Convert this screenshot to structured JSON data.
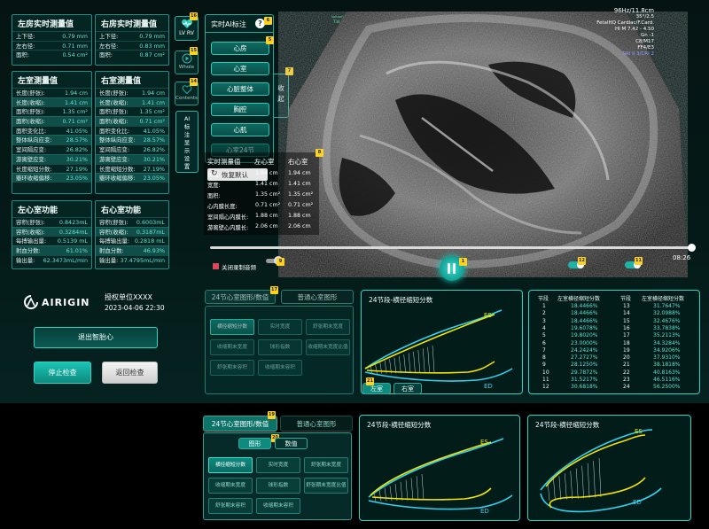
{
  "atrium_left": {
    "title": "左房实时测量值",
    "rows": [
      [
        "上下径:",
        "0.79 mm"
      ],
      [
        "左右径:",
        "0.71 mm"
      ],
      [
        "面积:",
        "0.54 cm²"
      ]
    ]
  },
  "atrium_right": {
    "title": "右房实时测量值",
    "rows": [
      [
        "上下径:",
        "0.79 mm"
      ],
      [
        "左右径:",
        "0.83 mm"
      ],
      [
        "面积:",
        "0.87 cm²"
      ]
    ]
  },
  "lv_measure": {
    "title": "左室测量值",
    "rows": [
      [
        "长度(舒张):",
        "1.94 cm"
      ],
      [
        "长度(收缩):",
        "1.41 cm"
      ],
      [
        "面积(舒张):",
        "1.35 cm²"
      ],
      [
        "面积(收缩):",
        "0.71 cm²"
      ],
      [
        "面积变化比:",
        "41.05%"
      ],
      [
        "整体纵向应变:",
        "28.57%"
      ],
      [
        "室间隔应变:",
        "26.82%"
      ],
      [
        "游离壁应变:",
        "30.21%"
      ],
      [
        "长度缩短分数:",
        "27.19%"
      ],
      [
        "瓣环收缩偏移:",
        "23.05%"
      ]
    ]
  },
  "rv_measure": {
    "title": "右室测量值",
    "rows": [
      [
        "长度(舒张):",
        "1.94 cm"
      ],
      [
        "长度(收缩):",
        "1.41 cm"
      ],
      [
        "面积(舒张):",
        "1.35 cm²"
      ],
      [
        "面积(收缩):",
        "0.71 cm²"
      ],
      [
        "面积变化比:",
        "41.05%"
      ],
      [
        "整体纵向应变:",
        "28.57%"
      ],
      [
        "室间隔应变:",
        "26.82%"
      ],
      [
        "游离壁应变:",
        "30.21%"
      ],
      [
        "长度缩短分数:",
        "27.19%"
      ],
      [
        "瓣环收缩偏移:",
        "23.05%"
      ]
    ]
  },
  "lv_func": {
    "title": "左心室功能",
    "rows": [
      [
        "容积(舒张):",
        "0.8423mL"
      ],
      [
        "容积(收缩):",
        "0.3284mL"
      ],
      [
        "每搏输出量:",
        "0.5139 mL"
      ],
      [
        "射血分数:",
        "61.01%"
      ],
      [
        "输出量:",
        "62.3473mL/min"
      ]
    ]
  },
  "rv_func": {
    "title": "右心室功能",
    "rows": [
      [
        "容积(舒张):",
        "0.6003mL"
      ],
      [
        "容积(收缩):",
        "0.3187mL"
      ],
      [
        "每搏输出量:",
        "0.2818 mL"
      ],
      [
        "射血分数:",
        "46.93%"
      ],
      [
        "输出量:",
        "37.4795mL/min"
      ]
    ]
  },
  "views": [
    {
      "label": "LV RV",
      "badge": "16"
    },
    {
      "label": "Whole",
      "badge": "15"
    },
    {
      "label": "Contents",
      "badge": "14"
    }
  ],
  "ai_side_label": "AI标注显示设置",
  "ai_panel": {
    "title": "实时AI标注",
    "badge_title": "6",
    "badge_side": "7",
    "badge_list": "5",
    "collapse": "收起",
    "items": [
      "心房",
      "心室",
      "心脏整体",
      "胸腔",
      "心肌",
      "心室24节"
    ]
  },
  "realtime": {
    "title": "实时测量值",
    "left_col": "左心室",
    "right_col": "右心室",
    "restore": "恢复默认",
    "badge": "8",
    "rows": [
      [
        "长度:",
        "1.94 cm",
        "1.94 cm"
      ],
      [
        "宽度:",
        "1.41 cm",
        "1.41 cm"
      ],
      [
        "面积:",
        "1.35 cm²",
        "1.35 cm²"
      ],
      [
        "心内膜长度:",
        "0.71 cm²",
        "0.71 cm²"
      ],
      [
        "室间隔心内膜长:",
        "1.88 cm",
        "1.88 cm"
      ],
      [
        "游离壁心内膜长:",
        "2.06 cm",
        "2.06 cm"
      ]
    ]
  },
  "us_overlay": {
    "freq": "96Hz/11.8cm",
    "l1": "35°/2.5",
    "l2": "FetalHQ Cardiac/F.Card.",
    "l3": "HI M  7.42 - 4.50",
    "l4": "Gn  -1",
    "l5": "C8/M17",
    "l6": "FF4/E3",
    "l7": "SRI II 3/CRI 2",
    "lvol": "Volusoh",
    "lvol2": "T30"
  },
  "player": {
    "time": "08:26",
    "record_label": "关闭录制音频",
    "badge_pause": "1",
    "badge_play": "12",
    "badge_a": "10",
    "badge_b": "11",
    "badge_c": "9"
  },
  "brand": {
    "name": "AIRIGIN",
    "license": "授权单位XXXX",
    "datetime": "2023-04-06 22:30"
  },
  "buttons": {
    "exit": "退出智胎心",
    "stop": "停止检查",
    "back": "返回检查"
  },
  "seg_panel": {
    "tab1": "24节心室图形/数值",
    "tab2": "普通心室图形",
    "badge": "17",
    "options": [
      "横径缩短分数",
      "实时宽度",
      "舒张期末宽度",
      "收缩期末宽度",
      "球形指数",
      "收缩期末宽度比值",
      "舒张期末容积",
      "收缩期末容积"
    ]
  },
  "chart_main": {
    "title": "24节段-横径缩短分数",
    "es": "ES",
    "ed": "ED",
    "tab_lv": "左室",
    "tab_rv": "右室",
    "badge": "21"
  },
  "seg_table": {
    "h1": "节段",
    "h2": "左室横径缩短分数",
    "h3": "节段",
    "h4": "左室横径缩短分数",
    "left": [
      [
        "1",
        "18.4466%"
      ],
      [
        "2",
        "18.4466%"
      ],
      [
        "3",
        "18.4466%"
      ],
      [
        "4",
        "19.6078%"
      ],
      [
        "5",
        "19.8020%"
      ],
      [
        "6",
        "23.0000%"
      ],
      [
        "7",
        "24.2424%"
      ],
      [
        "8",
        "27.2727%"
      ],
      [
        "9",
        "28.1250%"
      ],
      [
        "10",
        "29.7872%"
      ],
      [
        "11",
        "31.5217%"
      ],
      [
        "12",
        "30.6818%"
      ]
    ],
    "right": [
      [
        "13",
        "31.7647%"
      ],
      [
        "14",
        "32.0988%"
      ],
      [
        "15",
        "32.4676%"
      ],
      [
        "16",
        "33.7838%"
      ],
      [
        "17",
        "35.2113%"
      ],
      [
        "18",
        "34.3284%"
      ],
      [
        "19",
        "34.9206%"
      ],
      [
        "20",
        "37.9310%"
      ],
      [
        "21",
        "38.1818%"
      ],
      [
        "22",
        "40.8163%"
      ],
      [
        "23",
        "46.5116%"
      ],
      [
        "24",
        "56.2500%"
      ]
    ]
  },
  "bottom": {
    "tab1": "24节心室图形/数值",
    "tab2": "普通心室图形",
    "badge1": "19",
    "badge2": "20",
    "sub1": "图形",
    "sub2": "数值",
    "options": [
      "横径缩短分数",
      "实时宽度",
      "舒张期末宽度",
      "收缩期末宽度",
      "球形指数",
      "舒张期末宽度比值",
      "舒张期末容积",
      "收缩期末容积"
    ],
    "chart1": {
      "title": "24节段-横径缩短分数",
      "es": "ES",
      "ed": "ED"
    },
    "chart2": {
      "title": "24节段-横径缩短分数",
      "es": "ES",
      "ed": "ED"
    }
  },
  "colors": {
    "accent": "#2ad6c6",
    "es_curve": "#f5e400",
    "ed_curve": "#31d4f0",
    "value": "#5fe0d0"
  }
}
